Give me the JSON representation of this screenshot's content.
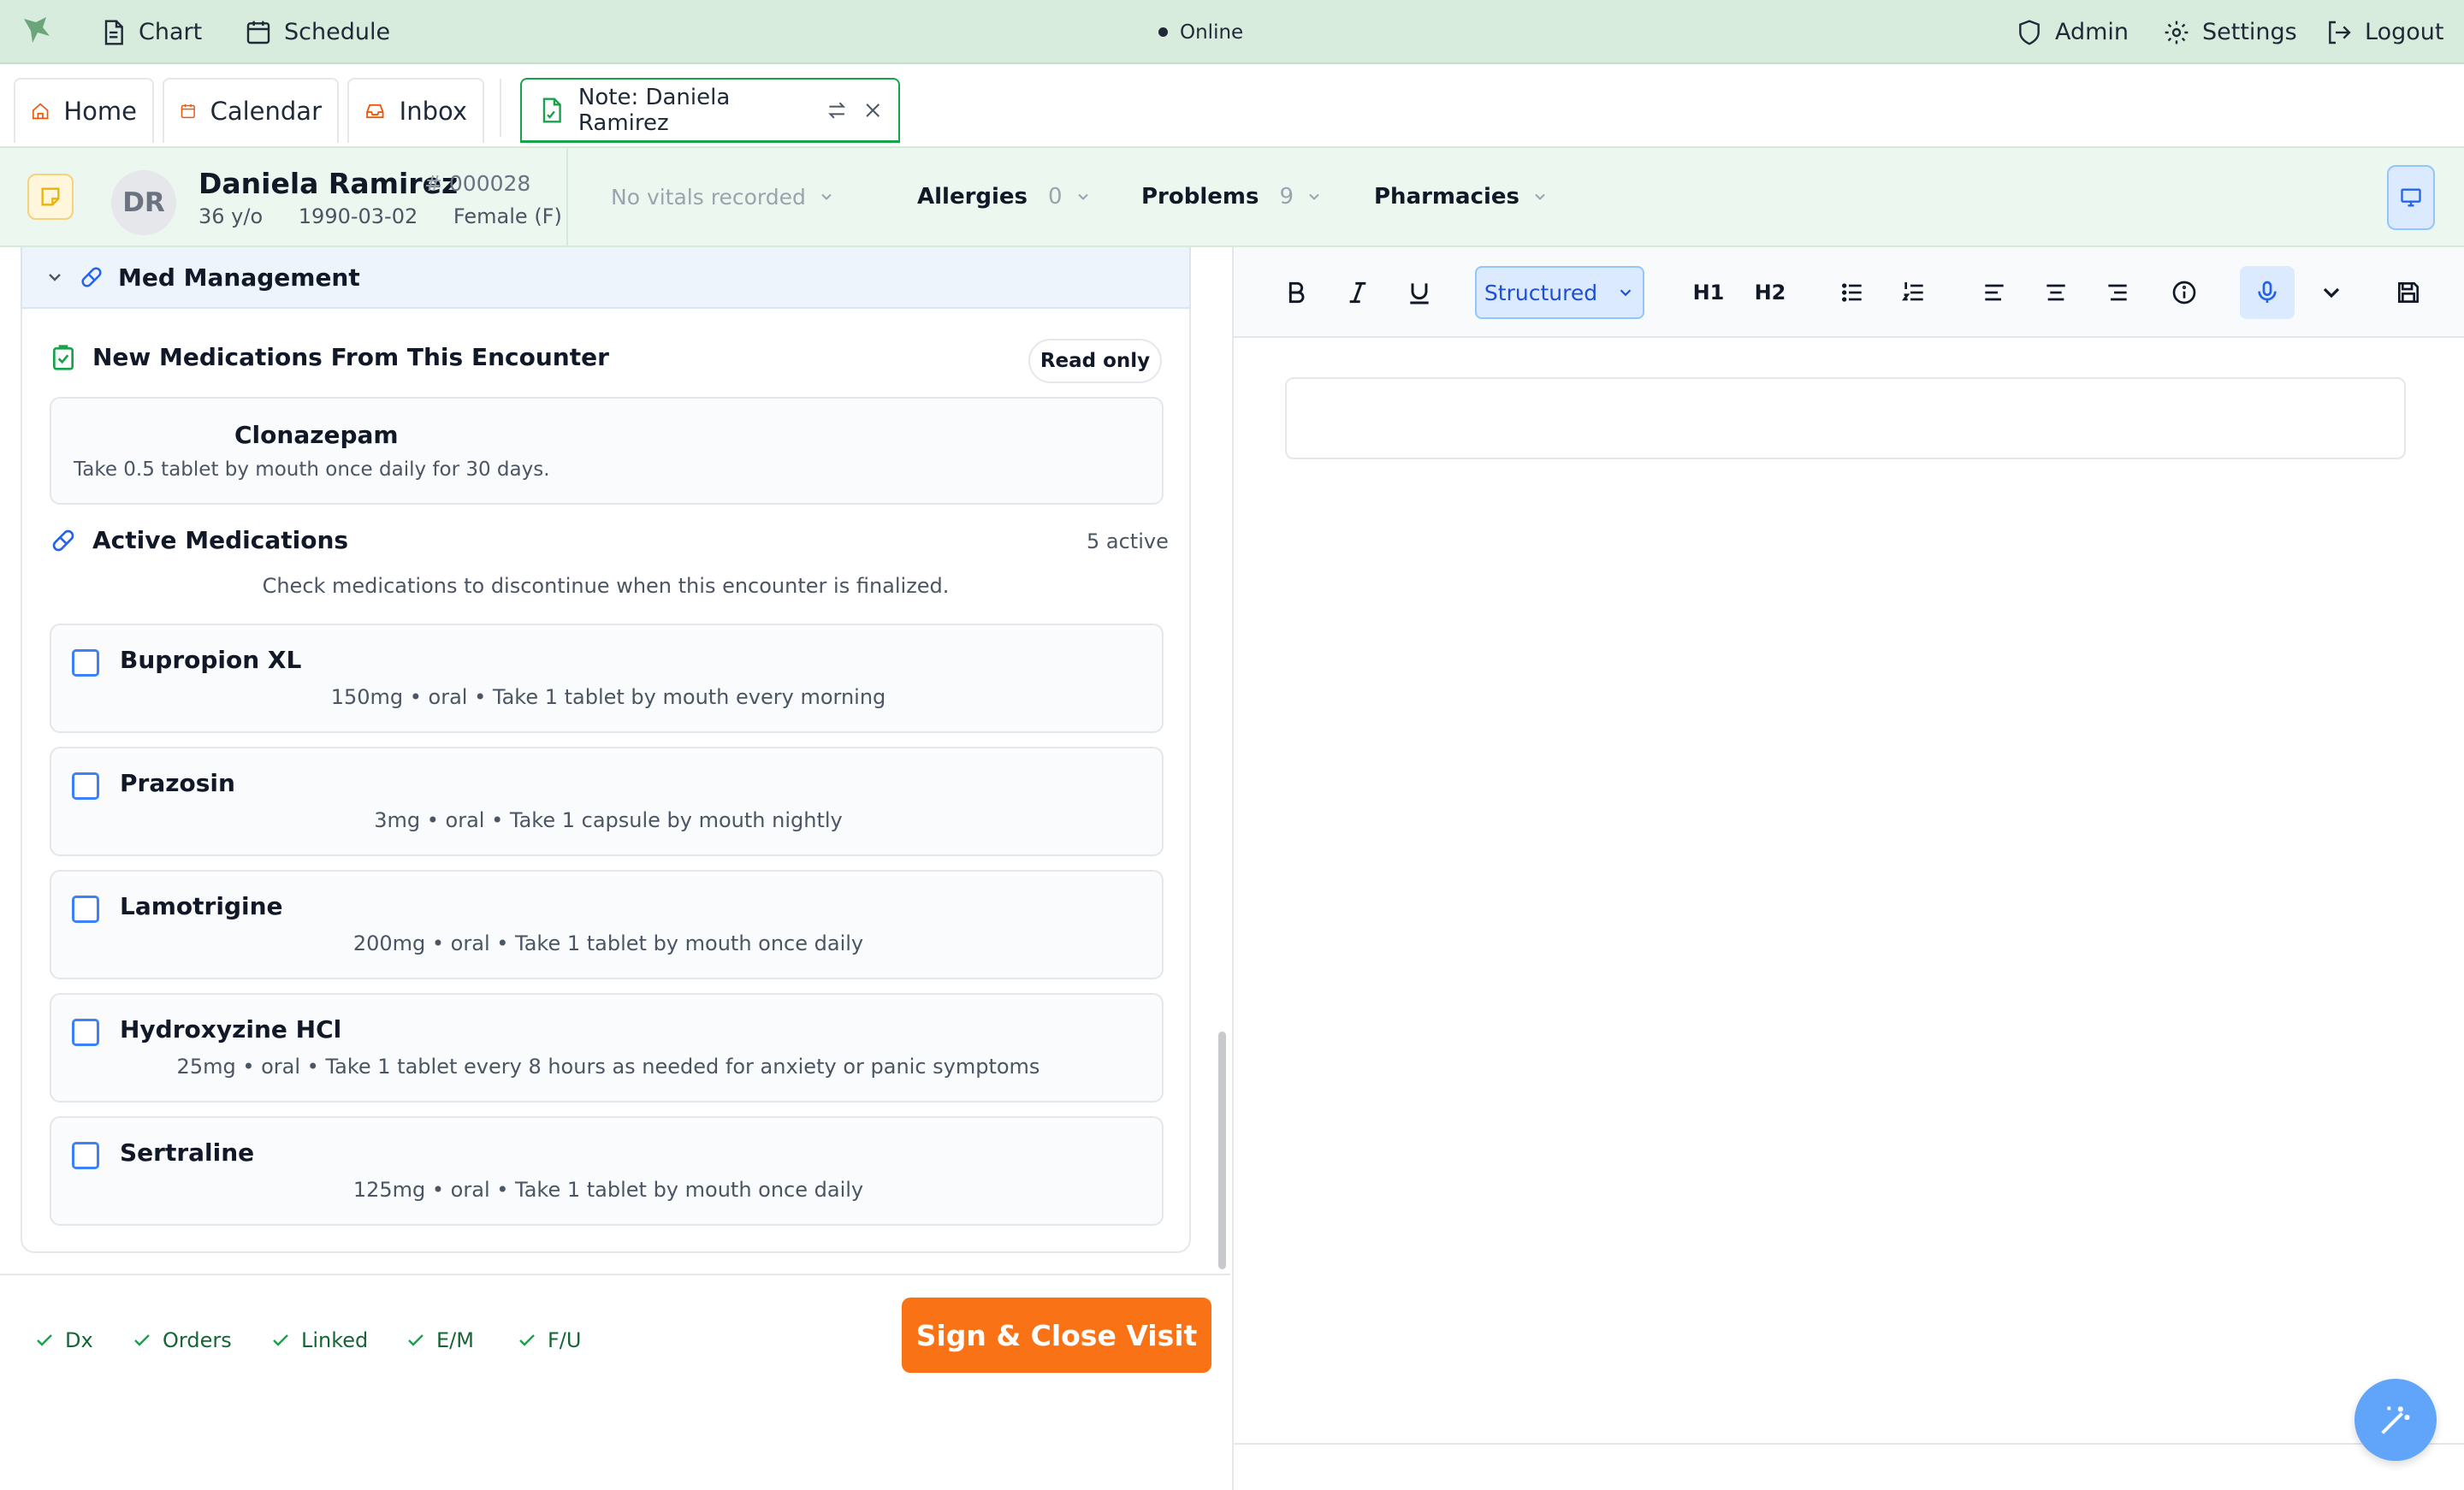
{
  "topbar": {
    "nav": [
      {
        "label": "Chart",
        "icon": "document-icon"
      },
      {
        "label": "Schedule",
        "icon": "calendar-icon"
      }
    ],
    "status": "Online",
    "right": [
      {
        "label": "Admin",
        "icon": "shield-icon"
      },
      {
        "label": "Settings",
        "icon": "gear-icon"
      },
      {
        "label": "Logout",
        "icon": "logout-icon"
      }
    ]
  },
  "tabs": [
    {
      "label": "Home",
      "icon": "home-icon"
    },
    {
      "label": "Calendar",
      "icon": "calendar-icon"
    },
    {
      "label": "Inbox",
      "icon": "inbox-icon"
    },
    {
      "label": "Note: Daniela Ramirez",
      "icon": "note-icon",
      "active": true
    }
  ],
  "patient": {
    "initials": "DR",
    "name": "Daniela Ramirez",
    "id": "000028",
    "age": "36 y/o",
    "dob": "1990-03-02",
    "sex": "Female (F)",
    "vitals": "No vitals recorded",
    "allergies_label": "Allergies",
    "allergies_count": "0",
    "problems_label": "Problems",
    "problems_count": "9",
    "pharmacies_label": "Pharmacies"
  },
  "med_management": {
    "title": "Med Management",
    "new_meds_title": "New Medications From This Encounter",
    "read_only": "Read only",
    "new_meds": [
      {
        "name": "Clonazepam",
        "sig": "Take 0.5 tablet by mouth once daily for 30 days."
      }
    ],
    "active_title": "Active Medications",
    "active_count": "5 active",
    "hint": "Check medications to discontinue when this encounter is finalized.",
    "active": [
      {
        "name": "Bupropion XL",
        "details": "150mg • oral • Take 1 tablet by mouth every morning"
      },
      {
        "name": "Prazosin",
        "details": "3mg • oral • Take 1 capsule by mouth nightly"
      },
      {
        "name": "Lamotrigine",
        "details": "200mg • oral • Take 1 tablet by mouth once daily"
      },
      {
        "name": "Hydroxyzine HCl",
        "details": "25mg • oral • Take 1 tablet every 8 hours as needed for anxiety or panic symptoms"
      },
      {
        "name": "Sertraline",
        "details": "125mg • oral • Take 1 tablet by mouth once daily"
      }
    ]
  },
  "footer": {
    "checks": [
      "Dx",
      "Orders",
      "Linked",
      "E/M",
      "F/U"
    ],
    "sign_button": "Sign & Close Visit"
  },
  "editor": {
    "mode": "Structured",
    "h1": "H1",
    "h2": "H2"
  },
  "colors": {
    "accent_green": "#16a34a",
    "sign_orange": "#f97316",
    "link_blue": "#3b82f6"
  }
}
